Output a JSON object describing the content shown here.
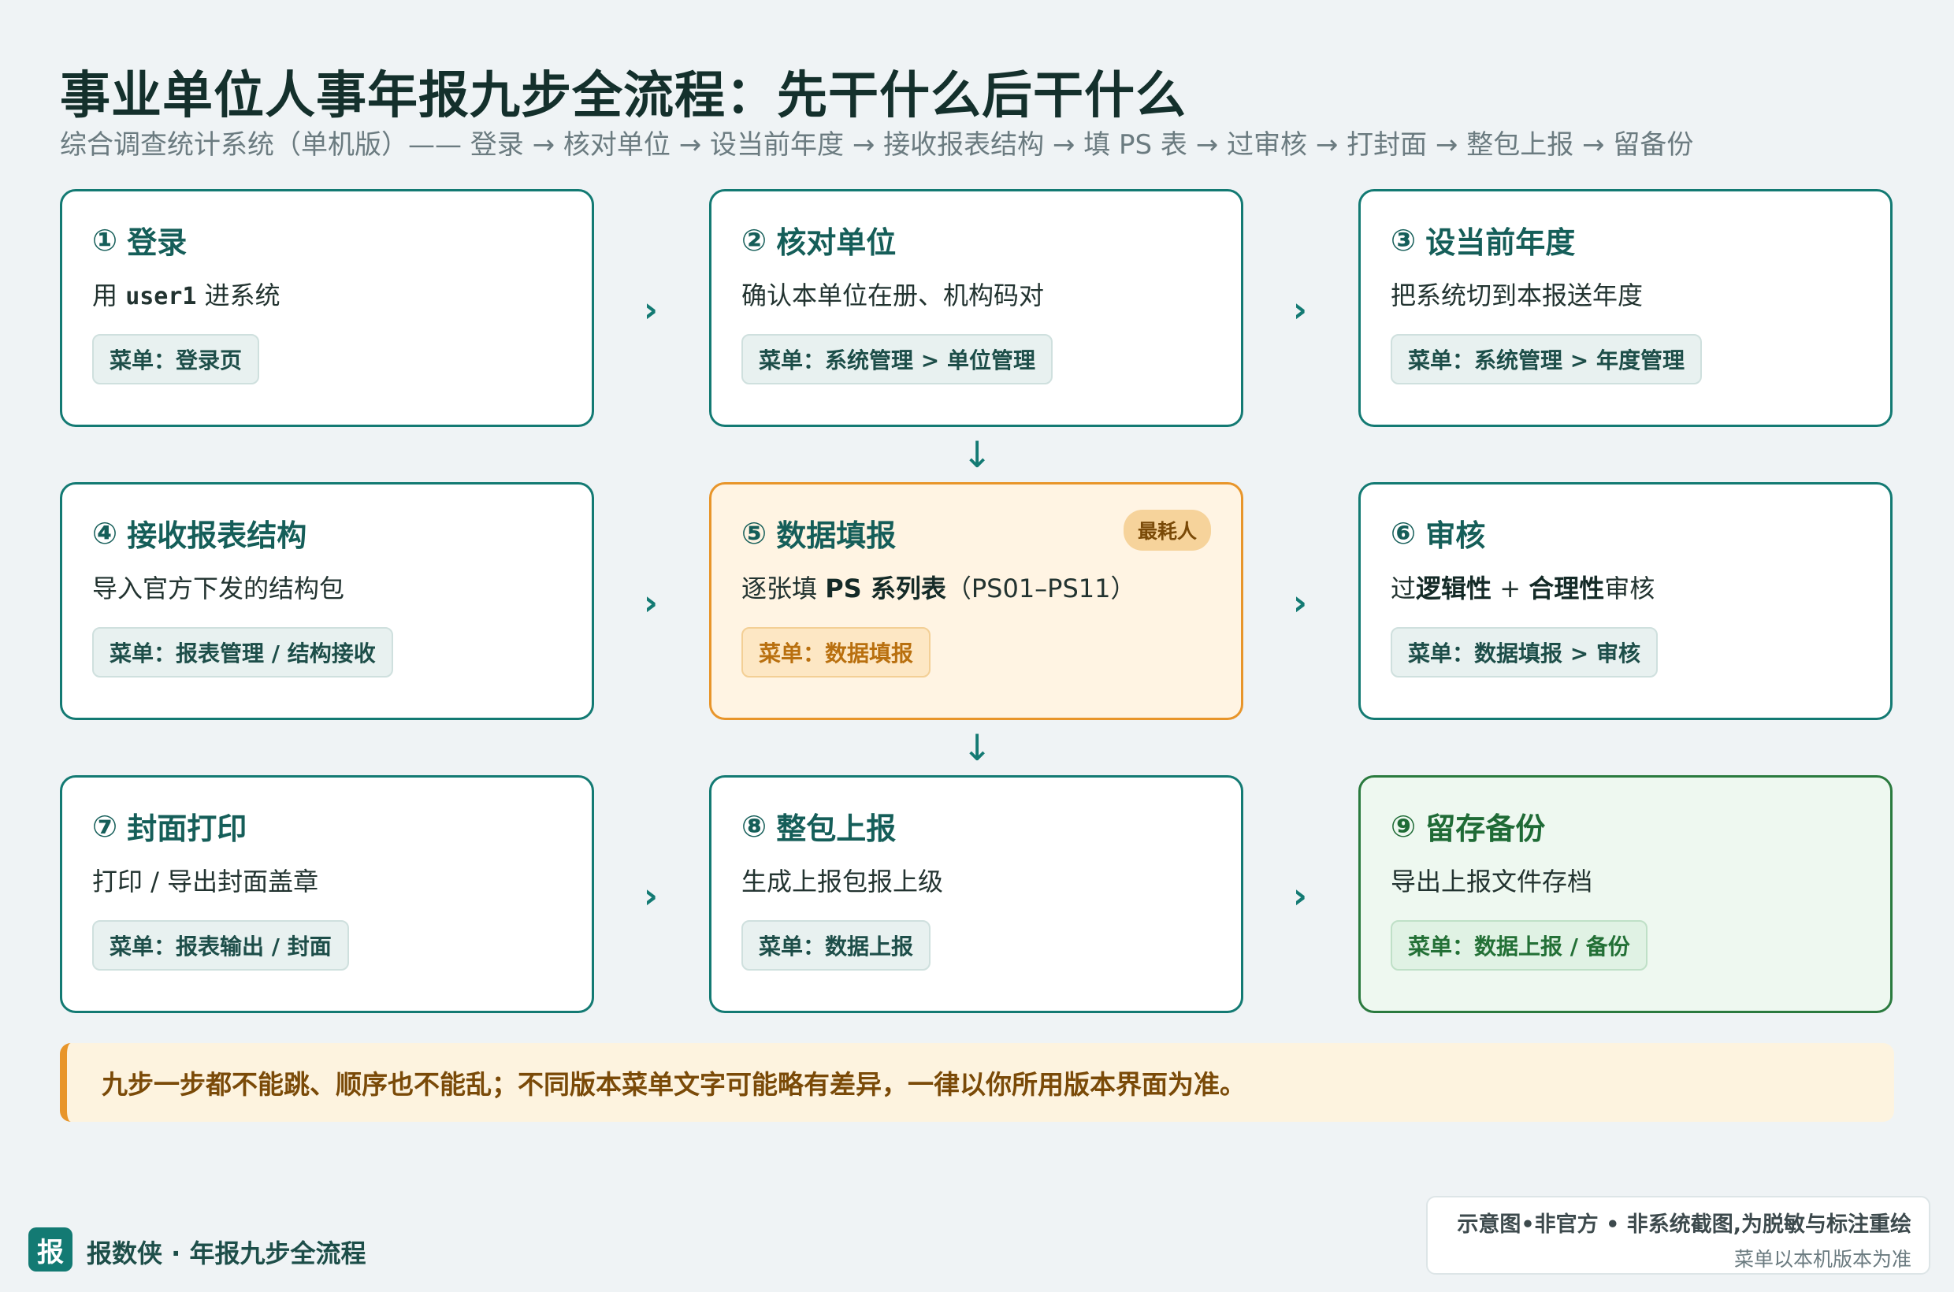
{
  "header": {
    "title": "事业单位人事年报九步全流程：先干什么后干什么",
    "subtitle": "综合调查统计系统（单机版）—— 登录 → 核对单位 → 设当前年度 → 接收报表结构 → 填 PS 表 → 过审核 → 打封面 → 整包上报 → 留备份"
  },
  "steps": [
    {
      "num": "①",
      "title": "登录",
      "desc_pre": "用 ",
      "desc_code": "user1",
      "desc_post": " 进系统",
      "menu": "菜单：登录页"
    },
    {
      "num": "②",
      "title": "核对单位",
      "desc": "确认本单位在册、机构码对",
      "menu": "菜单：系统管理 > 单位管理"
    },
    {
      "num": "③",
      "title": "设当前年度",
      "desc": "把系统切到本报送年度",
      "menu": "菜单：系统管理 > 年度管理"
    },
    {
      "num": "④",
      "title": "接收报表结构",
      "desc": "导入官方下发的结构包",
      "menu": "菜单：报表管理 / 结构接收"
    },
    {
      "num": "⑤",
      "title": "数据填报",
      "badge": "最耗人",
      "desc_pre": "逐张填 ",
      "desc_bold": "PS 系列表",
      "desc_post": "（PS01–PS11）",
      "menu": "菜单：数据填报"
    },
    {
      "num": "⑥",
      "title": "审核",
      "desc_pre": "过",
      "desc_bold1": "逻辑性",
      "desc_mid": " + ",
      "desc_bold2": "合理性",
      "desc_post": "审核",
      "menu": "菜单：数据填报 > 审核"
    },
    {
      "num": "⑦",
      "title": "封面打印",
      "desc": "打印 / 导出封面盖章",
      "menu": "菜单：报表输出 / 封面"
    },
    {
      "num": "⑧",
      "title": "整包上报",
      "desc": "生成上报包报上级",
      "menu": "菜单：数据上报"
    },
    {
      "num": "⑨",
      "title": "留存备份",
      "desc": "导出上报文件存档",
      "menu": "菜单：数据上报 / 备份"
    }
  ],
  "arrows": {
    "right": "›",
    "down": "↓"
  },
  "note": "九步一步都不能跳、顺序也不能乱；不同版本菜单文字可能略有差异，一律以你所用版本界面为准。",
  "footer": {
    "logo": "报",
    "brand": "报数侠 · 年报九步全流程",
    "disclaimer_1": "示意图•非官方 • 非系统截图,为脱敏与标注重绘",
    "disclaimer_2": "菜单以本机版本为准"
  },
  "colors": {
    "teal": "#137a73",
    "orange": "#e8952a",
    "green": "#2a7a3e",
    "background": "#eff3f5"
  }
}
